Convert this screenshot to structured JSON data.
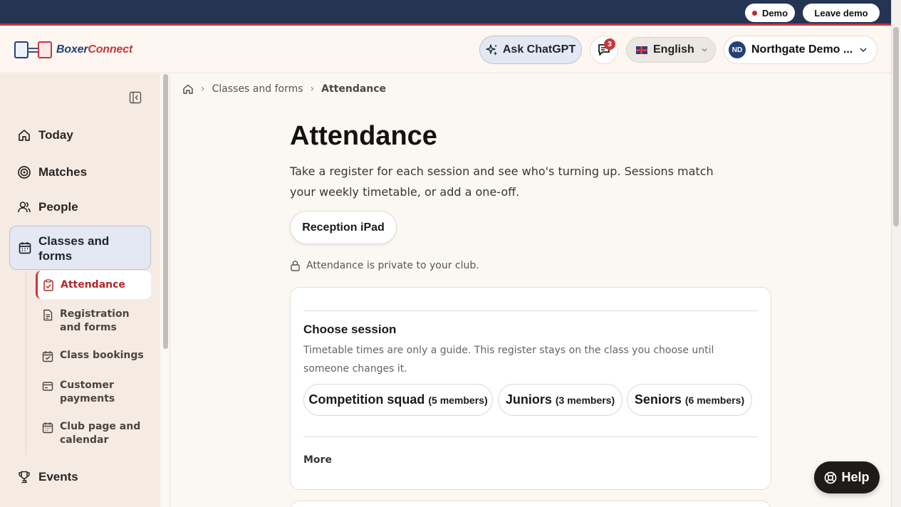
{
  "topbar": {
    "demo_label": "Demo",
    "leave_label": "Leave demo",
    "accent": "#c9373a",
    "background": "#243452"
  },
  "header": {
    "logo_primary": "Boxer",
    "logo_secondary": "Connect",
    "ask_label": "Ask ChatGPT",
    "messages_count": "3",
    "language": "English",
    "org_initials": "ND",
    "org_name": "Northgate Demo ..."
  },
  "sidebar": {
    "items": [
      {
        "label": "Today",
        "icon": "home-icon"
      },
      {
        "label": "Matches",
        "icon": "target-icon"
      },
      {
        "label": "People",
        "icon": "people-icon"
      },
      {
        "label": "Classes and forms",
        "icon": "calendar-icon"
      },
      {
        "label": "Events",
        "icon": "trophy-icon"
      }
    ],
    "subitems": [
      {
        "label": "Attendance",
        "icon": "clipboard-check-icon"
      },
      {
        "label": "Registration and forms",
        "icon": "document-icon"
      },
      {
        "label": "Class bookings",
        "icon": "calendar-check-icon"
      },
      {
        "label": "Customer payments",
        "icon": "wallet-icon"
      },
      {
        "label": "Club page and calendar",
        "icon": "calendar-icon"
      }
    ]
  },
  "breadcrumb": {
    "home_icon": "home-icon",
    "parent": "Classes and forms",
    "current": "Attendance"
  },
  "main": {
    "title": "Attendance",
    "description": "Take a register for each session and see who's turning up. Sessions match your weekly timetable, or add a one-off.",
    "device_label": "Reception iPad",
    "privacy_note": "Attendance is private to your club."
  },
  "session_card": {
    "title": "Choose session",
    "description": "Timetable times are only a guide. This register stays on the class you choose until someone changes it.",
    "sessions": [
      {
        "name": "Competition squad",
        "count": "(5 members)"
      },
      {
        "name": "Juniors",
        "count": "(3 members)"
      },
      {
        "name": "Seniors",
        "count": "(6 members)"
      }
    ],
    "more_label": "More"
  },
  "help": {
    "label": "Help"
  }
}
